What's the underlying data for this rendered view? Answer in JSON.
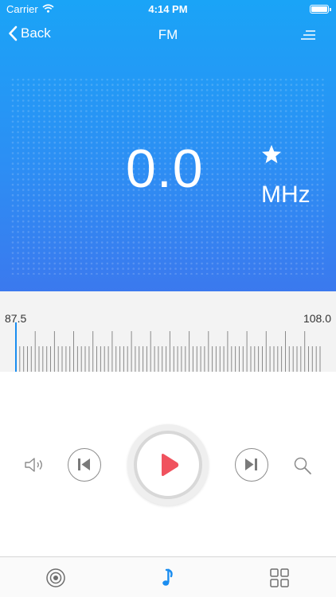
{
  "status_bar": {
    "carrier": "Carrier",
    "time": "4:14 PM"
  },
  "nav": {
    "back_label": "Back",
    "title": "FM"
  },
  "tuner": {
    "frequency": "0.0",
    "unit": "MHz"
  },
  "dial": {
    "min_label": "87.5",
    "max_label": "108.0",
    "needle_position": 0.0
  },
  "colors": {
    "gradient_top": "#1aa4f7",
    "gradient_bottom": "#3b79ee",
    "accent_blue": "#1a8df0",
    "play_red": "#f0525e"
  },
  "icons": {
    "back": "chevron-left-icon",
    "menu": "menu-lines-icon",
    "favorite": "star-icon",
    "volume": "speaker-icon",
    "prev": "skip-previous-icon",
    "play": "play-icon",
    "next": "skip-next-icon",
    "search": "magnifier-icon",
    "tab_radio": "radio-target-icon",
    "tab_music": "music-note-icon",
    "tab_more": "grid-icon"
  }
}
